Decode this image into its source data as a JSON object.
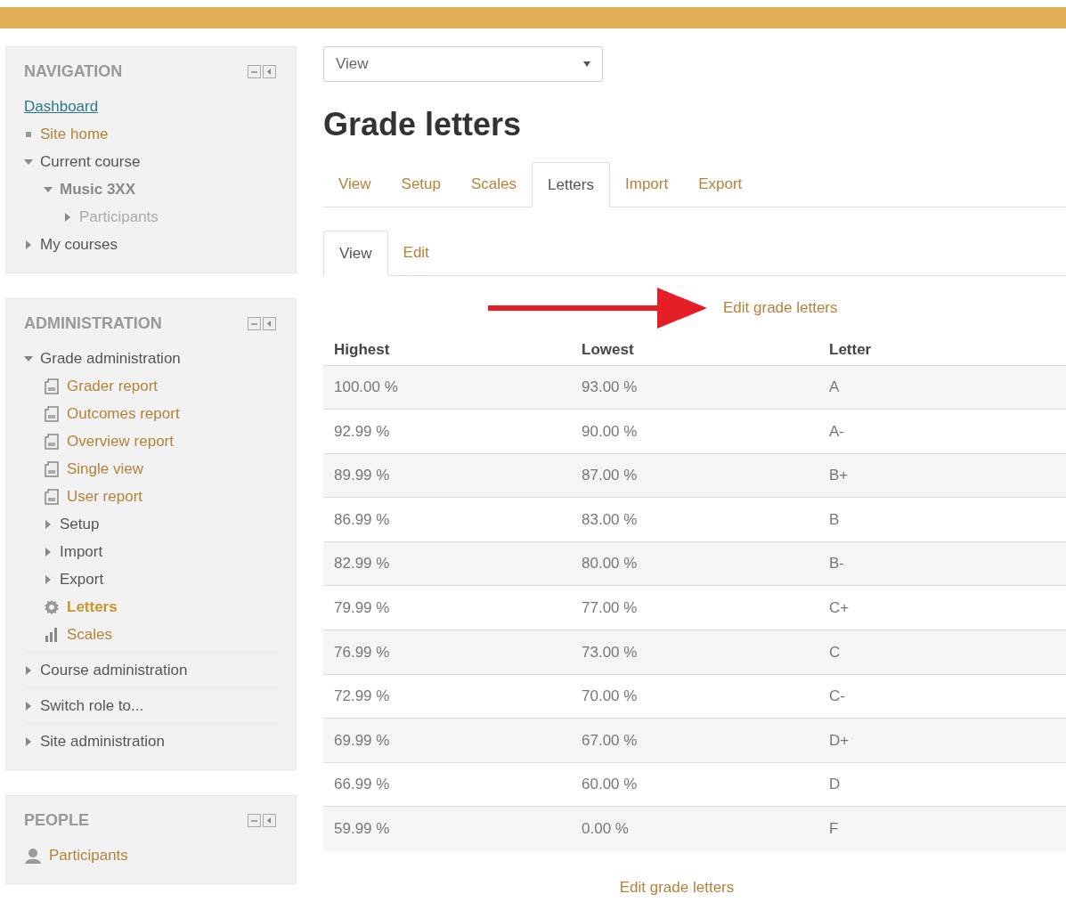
{
  "navigation": {
    "title": "NAVIGATION",
    "items": [
      {
        "label": "Dashboard",
        "kind": "dashboard"
      },
      {
        "label": "Site home",
        "kind": "link"
      },
      {
        "label": "Current course",
        "kind": "branch",
        "expanded": true,
        "children": [
          {
            "label": "Music 3XX",
            "kind": "course",
            "expanded": true,
            "children": [
              {
                "label": "Participants",
                "kind": "muted",
                "expanded": false
              }
            ]
          }
        ]
      },
      {
        "label": "My courses",
        "kind": "branch",
        "expanded": false
      }
    ]
  },
  "administration": {
    "title": "ADMINISTRATION",
    "items": [
      {
        "label": "Grade administration",
        "kind": "branch",
        "expanded": true,
        "children": [
          {
            "label": "Grader report",
            "kind": "report",
            "selected": false
          },
          {
            "label": "Outcomes report",
            "kind": "report",
            "selected": false
          },
          {
            "label": "Overview report",
            "kind": "report",
            "selected": false
          },
          {
            "label": "Single view",
            "kind": "report",
            "selected": false
          },
          {
            "label": "User report",
            "kind": "report",
            "selected": false
          },
          {
            "label": "Setup",
            "kind": "branch",
            "expanded": false,
            "selected": false
          },
          {
            "label": "Import",
            "kind": "branch",
            "expanded": false,
            "selected": false
          },
          {
            "label": "Export",
            "kind": "branch",
            "expanded": false,
            "selected": false
          },
          {
            "label": "Letters",
            "kind": "settings",
            "selected": true
          },
          {
            "label": "Scales",
            "kind": "scales",
            "selected": false
          }
        ]
      },
      {
        "label": "Course administration",
        "kind": "branch",
        "expanded": false
      },
      {
        "label": "Switch role to...",
        "kind": "branch",
        "expanded": false
      },
      {
        "label": "Site administration",
        "kind": "branch",
        "expanded": false
      }
    ]
  },
  "people": {
    "title": "PEOPLE",
    "items": [
      {
        "label": "Participants",
        "kind": "people"
      }
    ]
  },
  "view_select": {
    "value": "View"
  },
  "title": "Grade letters",
  "tabs": [
    {
      "label": "View",
      "selected": false
    },
    {
      "label": "Setup",
      "selected": false
    },
    {
      "label": "Scales",
      "selected": false
    },
    {
      "label": "Letters",
      "selected": true
    },
    {
      "label": "Import",
      "selected": false
    },
    {
      "label": "Export",
      "selected": false
    }
  ],
  "subtabs": [
    {
      "label": "View",
      "selected": true
    },
    {
      "label": "Edit",
      "selected": false
    }
  ],
  "edit_link_top": "Edit grade letters",
  "table": {
    "columns": [
      "Highest",
      "Lowest",
      "Letter"
    ],
    "rows": [
      [
        "100.00 %",
        "93.00 %",
        "A"
      ],
      [
        "92.99 %",
        "90.00 %",
        "A-"
      ],
      [
        "89.99 %",
        "87.00 %",
        "B+"
      ],
      [
        "86.99 %",
        "83.00 %",
        "B"
      ],
      [
        "82.99 %",
        "80.00 %",
        "B-"
      ],
      [
        "79.99 %",
        "77.00 %",
        "C+"
      ],
      [
        "76.99 %",
        "73.00 %",
        "C"
      ],
      [
        "72.99 %",
        "70.00 %",
        "C-"
      ],
      [
        "69.99 %",
        "67.00 %",
        "D+"
      ],
      [
        "66.99 %",
        "60.00 %",
        "D"
      ],
      [
        "59.99 %",
        "0.00 %",
        "F"
      ]
    ]
  },
  "edit_link_bottom": "Edit grade letters"
}
